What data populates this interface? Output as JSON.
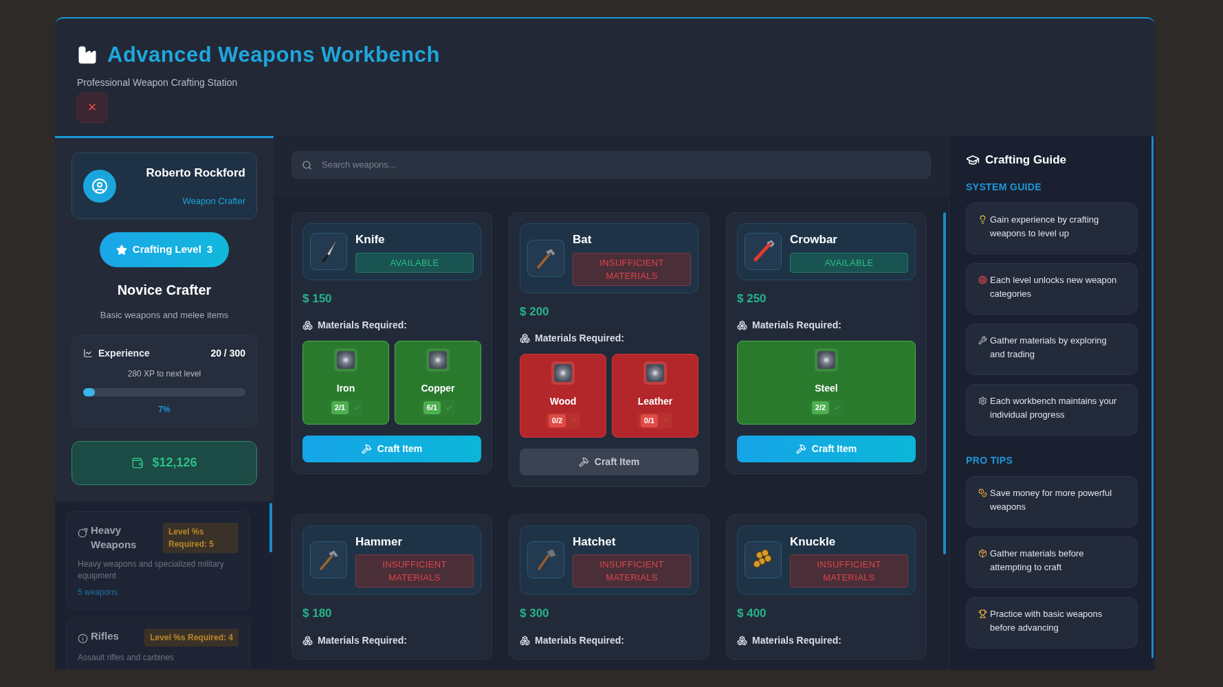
{
  "header": {
    "title": "Advanced Weapons Workbench",
    "subtitle": "Professional Weapon Crafting Station",
    "close": "✕"
  },
  "profile": {
    "name": "Roberto Rockford",
    "role": "Weapon Crafter"
  },
  "level": {
    "label": "Crafting Level",
    "value": "3"
  },
  "rank": {
    "title": "Novice Crafter",
    "description": "Basic weapons and melee items"
  },
  "experience": {
    "label": "Experience",
    "value": "20 / 300",
    "next": "280 XP to next level",
    "level": 0.07,
    "percent": "7%"
  },
  "money": "$12,126",
  "categories": [
    {
      "kind": "bomb",
      "name": "Heavy Weapons",
      "requirement": "Level %s Required: 5",
      "description": "Heavy weapons and specialized military equipment",
      "count": "5 weapons"
    },
    {
      "kind": "info",
      "name": "Rifles",
      "requirement": "Level %s Required: 4",
      "description": "Assault rifles and carbines"
    }
  ],
  "search": {
    "placeholder": "Search weapons..."
  },
  "weapons": [
    {
      "kind": "knife",
      "name": "Knife",
      "available": true,
      "status_label": "AVAILABLE",
      "price": "$ 150",
      "materials_label": "Materials Required:",
      "materials": [
        {
          "name": "Iron",
          "count": "2/1",
          "sufficient": true
        },
        {
          "name": "Copper",
          "count": "6/1",
          "sufficient": true
        }
      ],
      "button": "Craft Item",
      "enabled": true
    },
    {
      "kind": "hammer",
      "name": "Bat",
      "available": false,
      "status_label": "INSUFFICIENT MATERIALS",
      "price": "$ 200",
      "materials_label": "Materials Required:",
      "materials": [
        {
          "name": "Wood",
          "count": "0/2",
          "sufficient": false
        },
        {
          "name": "Leather",
          "count": "0/1",
          "sufficient": false
        }
      ],
      "button": "Craft Item",
      "enabled": false
    },
    {
      "kind": "wrench",
      "name": "Crowbar",
      "available": true,
      "status_label": "AVAILABLE",
      "price": "$ 250",
      "materials_label": "Materials Required:",
      "materials": [
        {
          "name": "Steel",
          "count": "2/2",
          "sufficient": true
        }
      ],
      "button": "Craft Item",
      "enabled": true
    },
    {
      "kind": "hammer",
      "name": "Hammer",
      "available": false,
      "status_label": "INSUFFICIENT MATERIALS",
      "price": "$ 180",
      "materials_label": "Materials Required:"
    },
    {
      "kind": "hatchet",
      "name": "Hatchet",
      "available": false,
      "status_label": "INSUFFICIENT MATERIALS",
      "price": "$ 300",
      "materials_label": "Materials Required:"
    },
    {
      "kind": "knuckle",
      "name": "Knuckle",
      "available": false,
      "status_label": "INSUFFICIENT MATERIALS",
      "price": "$ 400",
      "materials_label": "Materials Required:"
    }
  ],
  "guide": {
    "title": "Crafting Guide",
    "sections": [
      {
        "heading": "SYSTEM GUIDE",
        "tips": [
          {
            "kind": "bulb",
            "text": "Gain experience by crafting weapons to level up"
          },
          {
            "kind": "target",
            "text": "Each level unlocks new weapon categories"
          },
          {
            "kind": "wrench",
            "text": "Gather materials by exploring and trading"
          },
          {
            "kind": "gear",
            "text": "Each workbench maintains your individual progress"
          }
        ]
      },
      {
        "heading": "PRO TIPS",
        "tips": [
          {
            "kind": "moneybag",
            "text": "Save money for more powerful weapons"
          },
          {
            "kind": "package",
            "text": "Gather materials before attempting to craft"
          },
          {
            "kind": "trophy",
            "text": "Practice with basic weapons before advancing"
          }
        ]
      }
    ]
  }
}
